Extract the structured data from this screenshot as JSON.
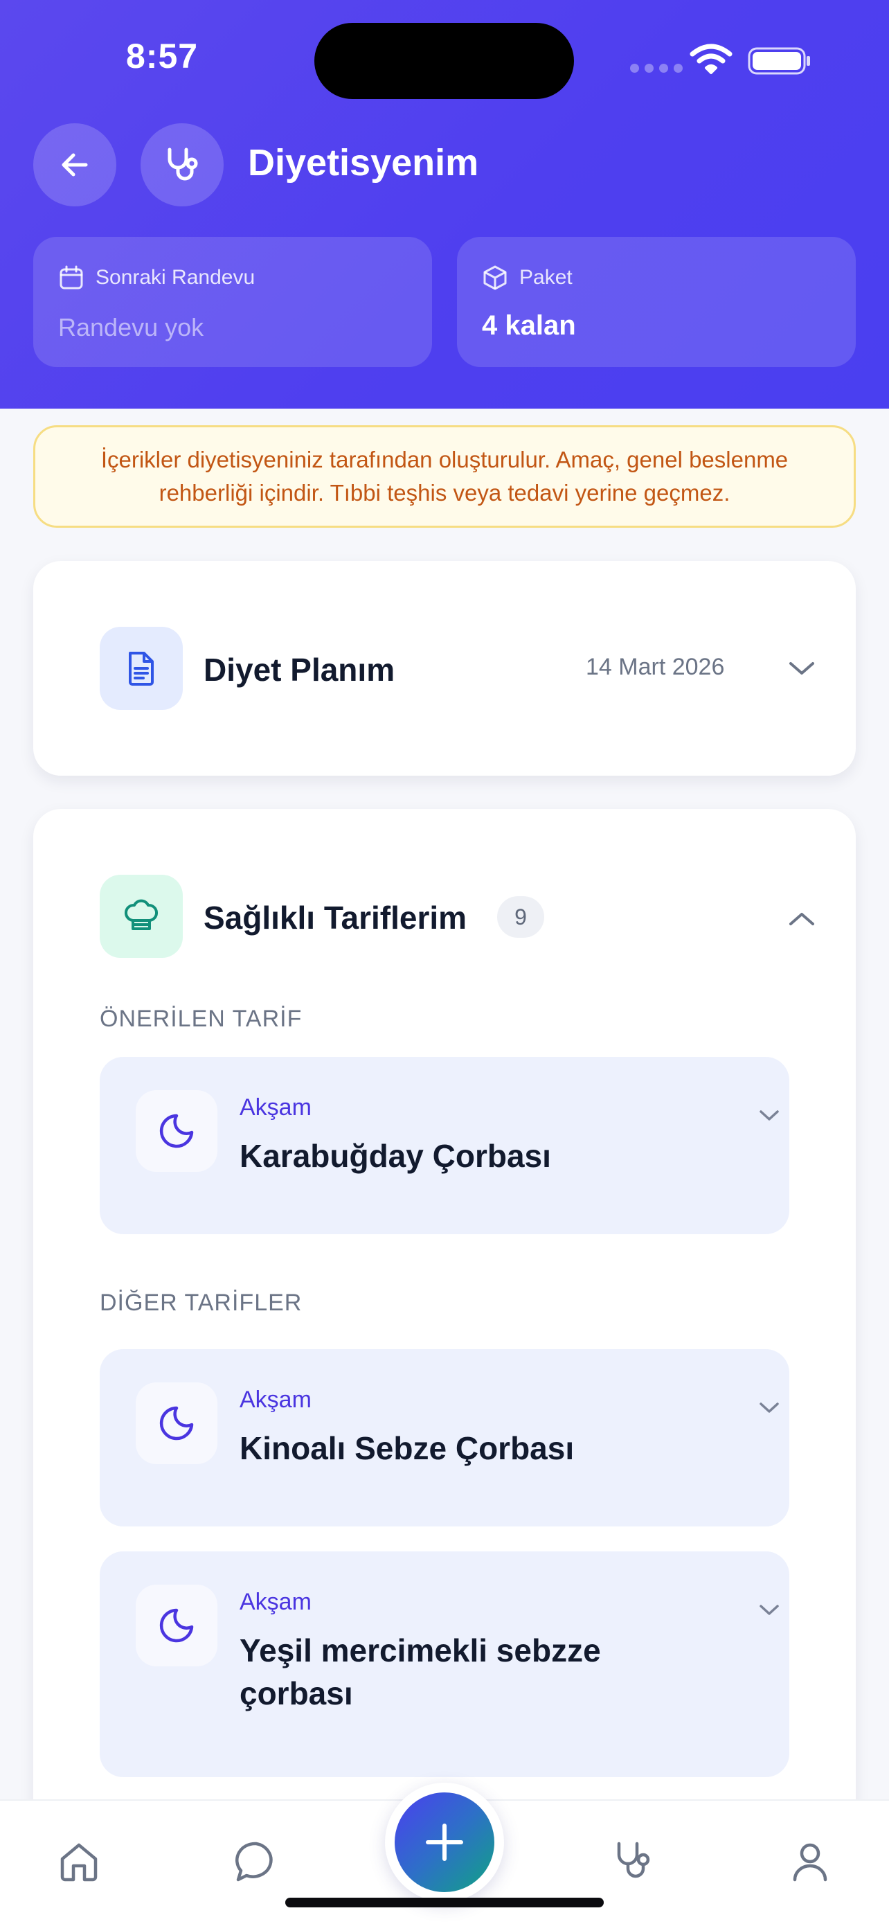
{
  "status_bar": {
    "time": "8:57"
  },
  "header": {
    "title": "Diyetisyenim",
    "next_appointment": {
      "label": "Sonraki Randevu",
      "value": "Randevu yok"
    },
    "package": {
      "label": "Paket",
      "value": "4 kalan"
    }
  },
  "disclaimer": {
    "text": "İçerikler diyetisyeniniz tarafından oluşturulur. Amaç, genel beslenme rehberliği içindir. Tıbbi teşhis veya tedavi yerine geçmez."
  },
  "diet_plan": {
    "title": "Diyet Planım",
    "date": "14 Mart 2026"
  },
  "recipes": {
    "title": "Sağlıklı Tariflerim",
    "count": "9",
    "recommended_label": "ÖNERİLEN TARİF",
    "others_label": "DİĞER TARİFLER",
    "recommended": {
      "meal": "Akşam",
      "name": "Karabuğday Çorbası"
    },
    "others": [
      {
        "meal": "Akşam",
        "name": "Kinoalı Sebze Çorbası"
      },
      {
        "meal": "Akşam",
        "name": "Yeşil mercimekli sebzze çorbası"
      }
    ]
  },
  "bottom_nav": {
    "items": [
      "home-icon",
      "chat-icon",
      "add-icon",
      "stethoscope-icon",
      "user-icon"
    ]
  },
  "colors": {
    "header_bg": "#5142ef",
    "accent": "#4a35e0",
    "warning_text": "#c25614",
    "warning_bg": "#fffbea",
    "recipe_bg": "#edf1fd"
  }
}
